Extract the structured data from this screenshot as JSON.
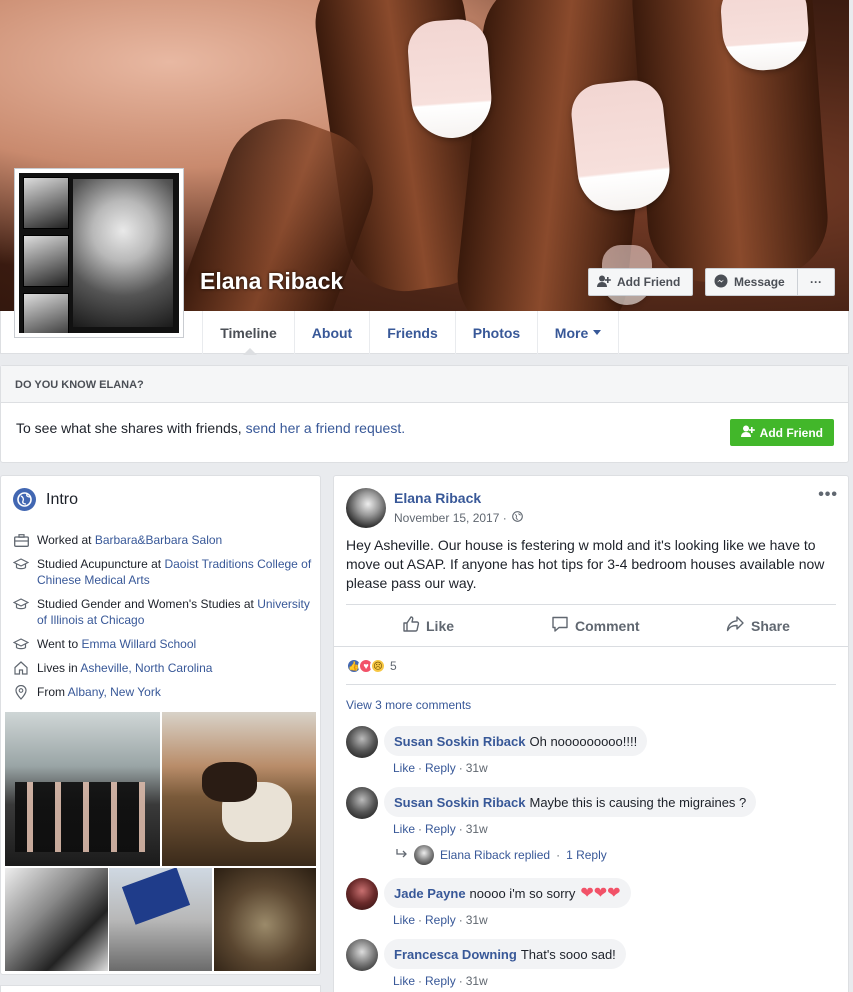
{
  "profile": {
    "name": "Elana Riback",
    "add_friend_label": "Add Friend",
    "message_label": "Message",
    "more_label": "···"
  },
  "nav": {
    "tabs": [
      {
        "label": "Timeline"
      },
      {
        "label": "About"
      },
      {
        "label": "Friends"
      },
      {
        "label": "Photos"
      },
      {
        "label": "More"
      }
    ]
  },
  "do_you_know": {
    "heading": "DO YOU KNOW ELANA?",
    "text_prefix": "To see what she shares with friends, ",
    "link_text": "send her a friend request.",
    "button_label": "Add Friend"
  },
  "intro": {
    "title": "Intro",
    "items": [
      {
        "prefix": "Worked at ",
        "link": "Barbara&Barbara Salon",
        "icon": "briefcase-icon"
      },
      {
        "prefix": "Studied Acupuncture at ",
        "link": "Daoist Traditions College of Chinese Medical Arts",
        "icon": "graduation-cap-icon"
      },
      {
        "prefix": "Studied Gender and Women's Studies at ",
        "link": "University of Illinois at Chicago",
        "icon": "graduation-cap-icon"
      },
      {
        "prefix": "Went to ",
        "link": "Emma Willard School",
        "icon": "graduation-cap-icon"
      },
      {
        "prefix": "Lives in ",
        "link": "Asheville, North Carolina",
        "icon": "home-icon"
      },
      {
        "prefix": "From ",
        "link": "Albany, New York",
        "icon": "location-pin-icon"
      }
    ]
  },
  "post": {
    "author": "Elana Riback",
    "date": "November 15, 2017 ·",
    "more": "•••",
    "text": "Hey Asheville. Our house is festering w mold and it's looking like we have to move out ASAP. If anyone has hot tips for 3-4 bedroom houses available now please pass our way.",
    "actions": {
      "like": "Like",
      "comment": "Comment",
      "share": "Share"
    },
    "reaction_count": "5",
    "view_more": "View 3 more comments",
    "comments": [
      {
        "name": "Susan Soskin Riback",
        "text": "Oh nooooooooo!!!!",
        "like": "Like",
        "reply": "Reply",
        "time": "31w"
      },
      {
        "name": "Susan Soskin Riback",
        "text": "Maybe this is causing the migraines ?",
        "like": "Like",
        "reply": "Reply",
        "time": "31w"
      },
      {
        "name": "Jade Payne",
        "text": "noooo i'm so sorry",
        "like": "Like",
        "reply": "Reply",
        "time": "31w"
      },
      {
        "name": "Francesca Downing",
        "text": "That's sooo sad!",
        "like": "Like",
        "reply": "Reply",
        "time": "31w"
      }
    ],
    "reply_summary": {
      "text": "Elana Riback replied",
      "sep": "·",
      "count": "1 Reply"
    }
  },
  "colors": {
    "link": "#385898",
    "brand": "#4267b2",
    "green": "#42b72a",
    "heart": "#f25268"
  }
}
